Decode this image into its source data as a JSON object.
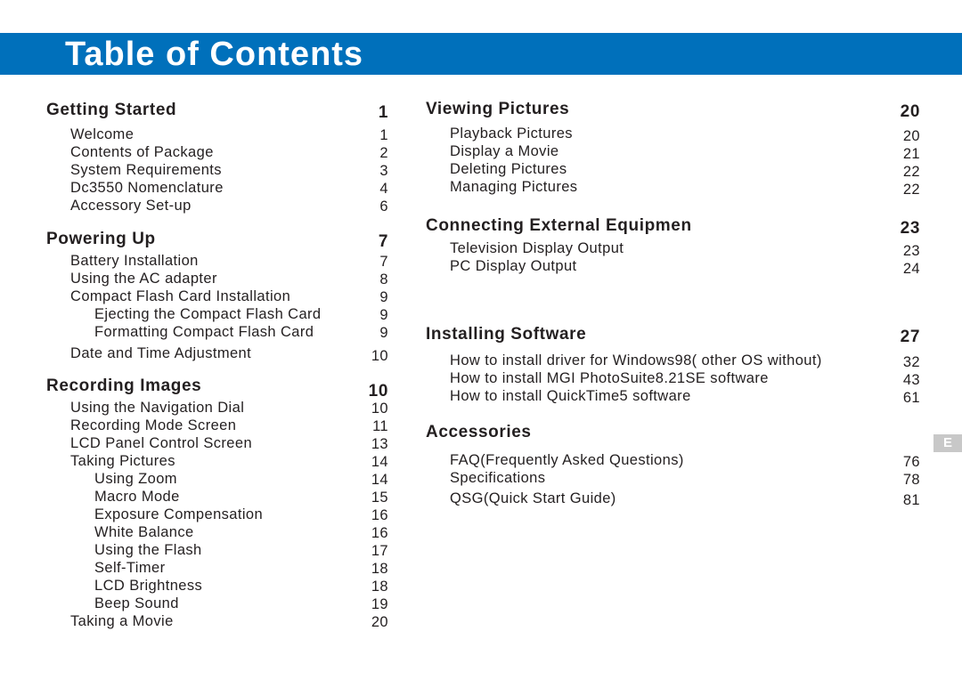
{
  "header": {
    "title": "Table of Contents"
  },
  "side_tab": {
    "label": "E"
  },
  "left_column": {
    "sections": [
      {
        "title": "Getting Started",
        "page": "1",
        "entries": [
          {
            "label": "Welcome",
            "page": "1",
            "level": 1
          },
          {
            "label": "Contents of Package",
            "page": "2",
            "level": 1
          },
          {
            "label": "System Requirements",
            "page": "3",
            "level": 1
          },
          {
            "label": "Dc3550 Nomenclature",
            "page": "4",
            "level": 1
          },
          {
            "label": "Accessory Set-up",
            "page": "6",
            "level": 1
          }
        ]
      },
      {
        "title": "Powering Up",
        "page": "7",
        "entries": [
          {
            "label": "Battery Installation",
            "page": "7",
            "level": 1
          },
          {
            "label": "Using the AC adapter",
            "page": "8",
            "level": 1
          },
          {
            "label": "Compact Flash Card Installation",
            "page": "9",
            "level": 1
          },
          {
            "label": "Ejecting the Compact Flash Card",
            "page": "9",
            "level": 2
          },
          {
            "label": "Formatting Compact Flash Card",
            "page": "9",
            "level": 2
          },
          {
            "label": "Date and Time Adjustment",
            "page": "10",
            "level": 1
          }
        ]
      },
      {
        "title": "Recording Images",
        "page": "10",
        "entries": [
          {
            "label": "Using the Navigation Dial",
            "page": "10",
            "level": 1
          },
          {
            "label": "Recording Mode Screen",
            "page": "11",
            "level": 1
          },
          {
            "label": "LCD Panel Control Screen",
            "page": "13",
            "level": 1
          },
          {
            "label": "Taking Pictures",
            "page": "14",
            "level": 1
          },
          {
            "label": "Using Zoom",
            "page": "14",
            "level": 2
          },
          {
            "label": "Macro Mode",
            "page": "15",
            "level": 2
          },
          {
            "label": "Exposure Compensation",
            "page": "16",
            "level": 2
          },
          {
            "label": "White Balance",
            "page": "16",
            "level": 2
          },
          {
            "label": "Using the Flash",
            "page": "17",
            "level": 2
          },
          {
            "label": "Self-Timer",
            "page": "18",
            "level": 2
          },
          {
            "label": "LCD Brightness",
            "page": "18",
            "level": 2
          },
          {
            "label": "Beep Sound",
            "page": "19",
            "level": 2
          },
          {
            "label": "Taking a Movie",
            "page": "20",
            "level": 1
          }
        ]
      }
    ]
  },
  "right_column": {
    "sections": [
      {
        "title": "Viewing Pictures",
        "page": "20",
        "entries": [
          {
            "label": "Playback Pictures",
            "page": "20",
            "level": 1
          },
          {
            "label": "Display a Movie",
            "page": "21",
            "level": 1
          },
          {
            "label": "Deleting Pictures",
            "page": "22",
            "level": 1
          },
          {
            "label": "Managing Pictures",
            "page": "22",
            "level": 1
          }
        ]
      },
      {
        "title": "Connecting External Equipmen",
        "page": "23",
        "entries": [
          {
            "label": "Television Display Output",
            "page": "23",
            "level": 1
          },
          {
            "label": "PC Display Output",
            "page": "24",
            "level": 1
          }
        ]
      },
      {
        "title": "Installing Software",
        "page": "27",
        "entries": [
          {
            "label": "How to install driver for Windows98( other OS without)",
            "page": "32",
            "level": 1
          },
          {
            "label": "How to install MGI PhotoSuite8.21SE software",
            "page": "43",
            "level": 1
          },
          {
            "label": "How to install QuickTime5 software",
            "page": "61",
            "level": 1
          }
        ]
      },
      {
        "title": "Accessories",
        "page": "",
        "entries": [
          {
            "label": "FAQ(Frequently Asked Questions)",
            "page": "76",
            "level": 1
          },
          {
            "label": "Specifications",
            "page": "78",
            "level": 1
          },
          {
            "label": "QSG(Quick Start  Guide)",
            "page": "81",
            "level": 1
          }
        ]
      }
    ]
  },
  "colors": {
    "banner": "#0070bb",
    "text": "#231f20",
    "side_tab": "#c8c8c8"
  }
}
